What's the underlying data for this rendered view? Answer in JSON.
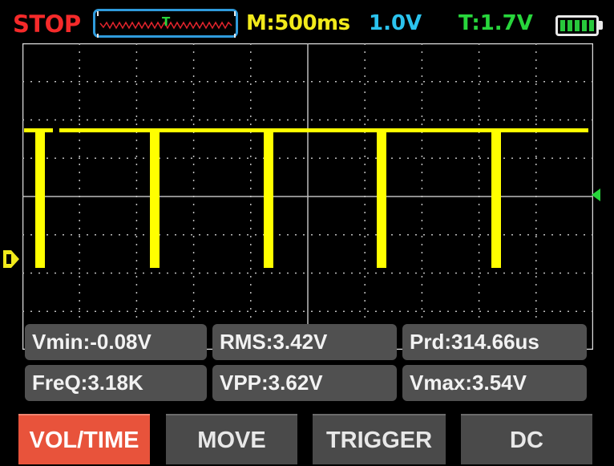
{
  "status_bar": {
    "run_state": "STOP",
    "timebase": "M:500ms",
    "volts_per_div": "1.0V",
    "trigger_level": "T:1.7V",
    "trigger_marker_letter": "T",
    "battery_cells": 5
  },
  "colors": {
    "stop": "#f52a2a",
    "timebase": "#f2ea1b",
    "volts": "#2bc3ee",
    "trigger": "#28d63c",
    "waveform": "#ffff00",
    "active_button": "#e8533b"
  },
  "screen": {
    "grid": true,
    "channel_marker": "D",
    "trigger_marker_icon": "left-triangle-icon"
  },
  "measurements": [
    {
      "label": "Vmin:-0.08V"
    },
    {
      "label": "RMS:3.42V"
    },
    {
      "label": "Prd:314.66us"
    },
    {
      "label": "FreQ:3.18K"
    },
    {
      "label": "VPP:3.62V"
    },
    {
      "label": "Vmax:3.54V"
    }
  ],
  "buttons": [
    {
      "label": "VOL/TIME",
      "active": true
    },
    {
      "label": "MOVE",
      "active": false
    },
    {
      "label": "TRIGGER",
      "active": false
    },
    {
      "label": "DC",
      "active": false
    }
  ]
}
